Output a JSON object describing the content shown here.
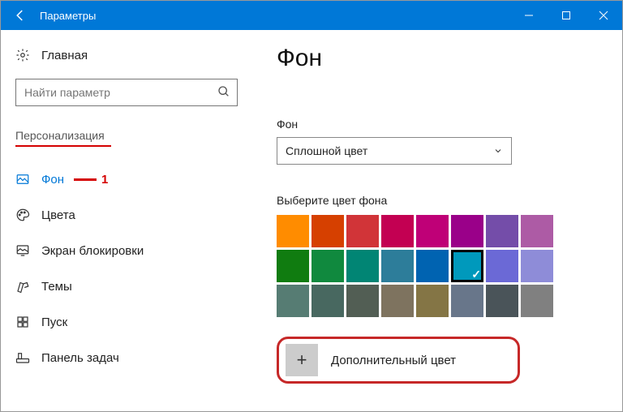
{
  "window": {
    "title": "Параметры"
  },
  "sidebar": {
    "home": "Главная",
    "search_placeholder": "Найти параметр",
    "category": "Персонализация",
    "items": [
      {
        "label": "Фон",
        "active": true,
        "annot": "1"
      },
      {
        "label": "Цвета"
      },
      {
        "label": "Экран блокировки"
      },
      {
        "label": "Темы"
      },
      {
        "label": "Пуск"
      },
      {
        "label": "Панель задач"
      }
    ]
  },
  "content": {
    "heading": "Фон",
    "bg_label": "Фон",
    "bg_select_value": "Сплошной цвет",
    "pick_label": "Выберите цвет фона",
    "colors_row1": [
      "#ff8c00",
      "#d64000",
      "#d13438",
      "#c30052",
      "#bf0077",
      "#9a0089",
      "#744da9",
      "#ad5ba5"
    ],
    "colors_row2": [
      "#107c10",
      "#10893e",
      "#018574",
      "#2d7d9a",
      "#0063b1",
      "#0099bc",
      "#6b69d6",
      "#8e8cd8"
    ],
    "colors_row3": [
      "#567c73",
      "#486860",
      "#525e54",
      "#7e735f",
      "#847545",
      "#68768a",
      "#4a5459",
      "#808080"
    ],
    "selected_color_index": 13,
    "custom_color_label": "Дополнительный цвет"
  }
}
